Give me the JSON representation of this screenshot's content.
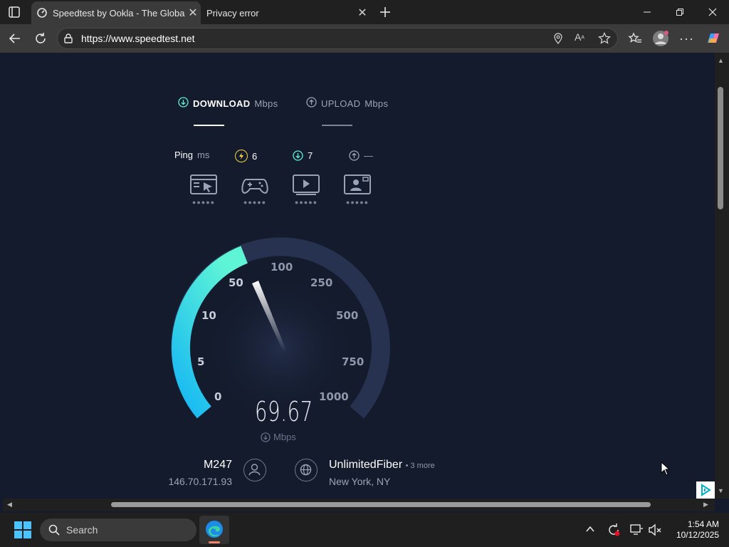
{
  "browser": {
    "tabs": [
      {
        "title": "Speedtest by Ookla - The Global B",
        "active": true
      },
      {
        "title": "Privacy error",
        "active": false
      }
    ],
    "url": "https://www.speedtest.net"
  },
  "speedtest": {
    "download_label": "DOWNLOAD",
    "download_unit": "Mbps",
    "upload_label": "UPLOAD",
    "upload_unit": "Mbps",
    "ping_label": "Ping",
    "ping_unit": "ms",
    "ping_idle": "6",
    "ping_down": "7",
    "ping_up": "—",
    "gauge_ticks": [
      "0",
      "5",
      "10",
      "50",
      "100",
      "250",
      "500",
      "750",
      "1000"
    ],
    "speed_value": "69.67",
    "speed_unit": "Mbps",
    "host_name": "M247",
    "host_ip": "146.70.171.93",
    "isp_name": "UnlimitedFiber",
    "isp_more": "• 3 more",
    "isp_location": "New York, NY",
    "colors": {
      "accent": "#5ef0d8",
      "gauge_fill": "#1fc4f0",
      "gauge_track": "#26324f"
    }
  },
  "taskbar": {
    "search_placeholder": "Search",
    "time": "1:54 AM",
    "date": "10/12/2025"
  }
}
